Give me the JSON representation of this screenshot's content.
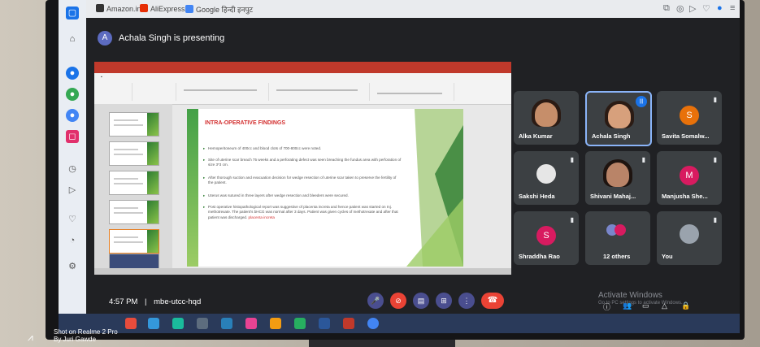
{
  "browser": {
    "bookmarks": [
      "Amazon.in",
      "AliExpress",
      "Google हिन्दी इनपुट"
    ]
  },
  "meet": {
    "presenter_initial": "A",
    "presenting_text": "Achala Singh is presenting",
    "time": "4:57 PM",
    "separator": "|",
    "meeting_code": "mbe-utcc-hqd"
  },
  "slide": {
    "title": "INTRA-OPERATIVE FINDINGS",
    "bullets": [
      "Hemoperitoneum of 400cc and blood clots of 700-800cc were noted.",
      "Site of uterine scar breach 75 weeks and a perforating defect was seen breaching the fundus area with perforation of size 3*3 cm.",
      "After thorough suction and evacuation decision for wedge resection of uterine scar taken to preserve the fertility of the patient.",
      "Uterus was sutured in three layers after wedge resection and bleeders were secured.",
      "Post operative histopathological report was suggestive of placenta increta and hence patient was started on Inj. methotrexate. The patient's bHCG was normal after 3 days. Patient was given cycles of methotrexate and after that patient was discharged."
    ],
    "highlight": "placenta increta"
  },
  "participants": [
    {
      "name": "Alka Kumar",
      "initial": "",
      "color": "#3c4043"
    },
    {
      "name": "Achala Singh",
      "initial": "",
      "color": "#3c4043"
    },
    {
      "name": "Savita Somalw...",
      "initial": "S",
      "color": "#e8710a"
    },
    {
      "name": "Sakshi Heda",
      "initial": "",
      "color": "#3c4043"
    },
    {
      "name": "Shivani Mahaj...",
      "initial": "",
      "color": "#3c4043"
    },
    {
      "name": "Manjusha She...",
      "initial": "M",
      "color": "#d81b60"
    },
    {
      "name": "Shraddha Rao",
      "initial": "S",
      "color": "#d81b60"
    },
    {
      "name": "12 others",
      "initial": "",
      "color": "#3c4043"
    },
    {
      "name": "You",
      "initial": "",
      "color": "#3c4043"
    }
  ],
  "windows": {
    "activate_title": "Activate Windows",
    "activate_sub": "Go to PC settings to activate Windows."
  },
  "watermark": {
    "line1": "Shot on Realme 2 Pro",
    "line2": "By Juri Gawde"
  },
  "icons": {
    "mic": "microphone-icon",
    "camera_off": "camera-off-icon",
    "captions": "captions-icon",
    "present": "present-icon",
    "more": "more-options-icon",
    "end_call": "end-call-icon"
  }
}
